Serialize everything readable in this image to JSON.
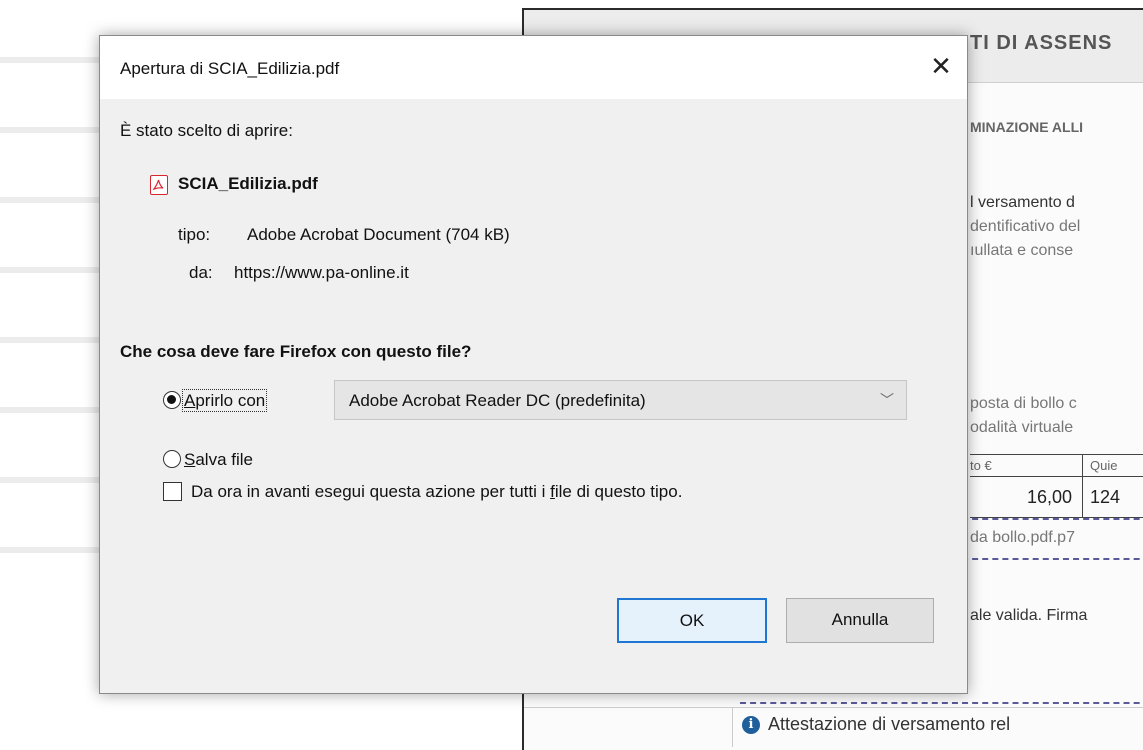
{
  "background": {
    "doc_title": "TI DI ASSENS",
    "doc_subtitle": "MINAZIONE ALLI",
    "lines": [
      "l versamento d",
      "dentificativo del",
      "ıullata e conse",
      "posta di bollo c",
      "odalità virtuale"
    ],
    "table": {
      "header_1": "to €",
      "header_2": "Quie",
      "value_1": "16,00",
      "value_2": "124"
    },
    "attachment": "da bollo.pdf.p7",
    "validity": "ale valida. Firma",
    "attestation": "Attestazione di versamento rel",
    "info_icon": "info-icon"
  },
  "dialog": {
    "title": "Apertura di SCIA_Edilizia.pdf",
    "close_icon": "close-icon",
    "intro": "È stato scelto di aprire:",
    "file_icon": "pdf-file-icon",
    "filename": "SCIA_Edilizia.pdf",
    "type_label": "tipo:",
    "type_value": "Adobe Acrobat Document (704 kB)",
    "from_label": "da:",
    "from_value": "https://www.pa-online.it",
    "question": "Che cosa deve fare Firefox con questo file?",
    "open_with": {
      "label_underlined": "A",
      "label_rest": "prirlo con",
      "checked": true
    },
    "app_select": {
      "value": "Adobe Acrobat Reader DC  (predefinita)",
      "icon": "chevron-down-icon"
    },
    "save_file": {
      "label_underlined": "S",
      "label_rest": "alva file",
      "checked": false
    },
    "remember": {
      "label_before": "Da ora in avanti esegui questa azione per tutti i ",
      "label_underlined": "f",
      "label_after": "ile di questo tipo.",
      "checked": false
    },
    "ok_label": "OK",
    "cancel_label": "Annulla"
  }
}
